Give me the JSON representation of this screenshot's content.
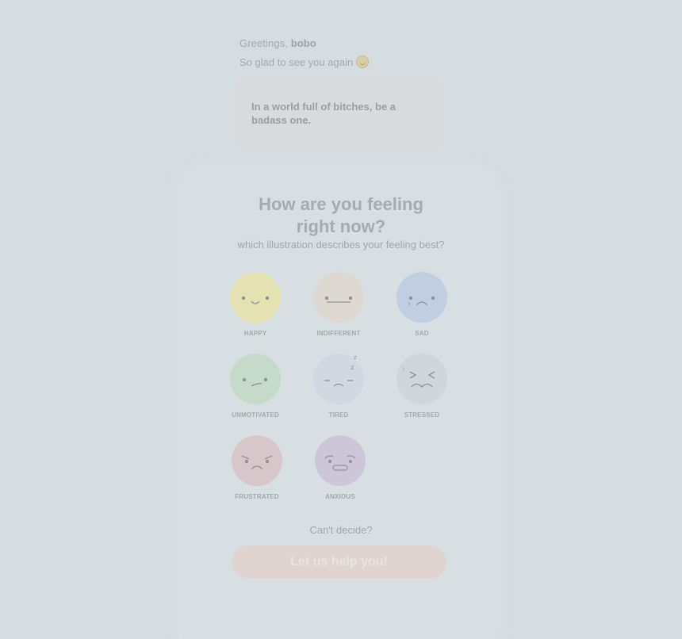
{
  "greeting": {
    "prefix": "Greetings, ",
    "name": "bobo",
    "subtitle": "So glad to see you again",
    "subtitle_icon": "smile-emoji-icon"
  },
  "quote": {
    "text": "In a world full of bitches, be a badass one."
  },
  "mood_card": {
    "title": "How are you feeling right now?",
    "question": "which illustration describes your feeling best?",
    "moods": [
      {
        "label": "HAPPY",
        "icon": "happy-face-icon",
        "color": "#e4e2b0"
      },
      {
        "label": "INDIFFERENT",
        "icon": "indifferent-face-icon",
        "color": "#ddd9d0"
      },
      {
        "label": "SAD",
        "icon": "sad-face-icon",
        "color": "#c1cde0"
      },
      {
        "label": "UNMOTIVATED",
        "icon": "unmotivated-face-icon",
        "color": "#c5dac9"
      },
      {
        "label": "TIRED",
        "icon": "tired-face-icon",
        "color": "#d3d7e2"
      },
      {
        "label": "STRESSED",
        "icon": "stressed-face-icon",
        "color": "#d0d6d9"
      },
      {
        "label": "FRUSTRATED",
        "icon": "frustrated-face-icon",
        "color": "#d7c6ca"
      },
      {
        "label": "ANXIOUS",
        "icon": "anxious-face-icon",
        "color": "#cdc6d9"
      }
    ],
    "cant_decide": "Can't decide?",
    "help_button": "Let us help you!"
  }
}
